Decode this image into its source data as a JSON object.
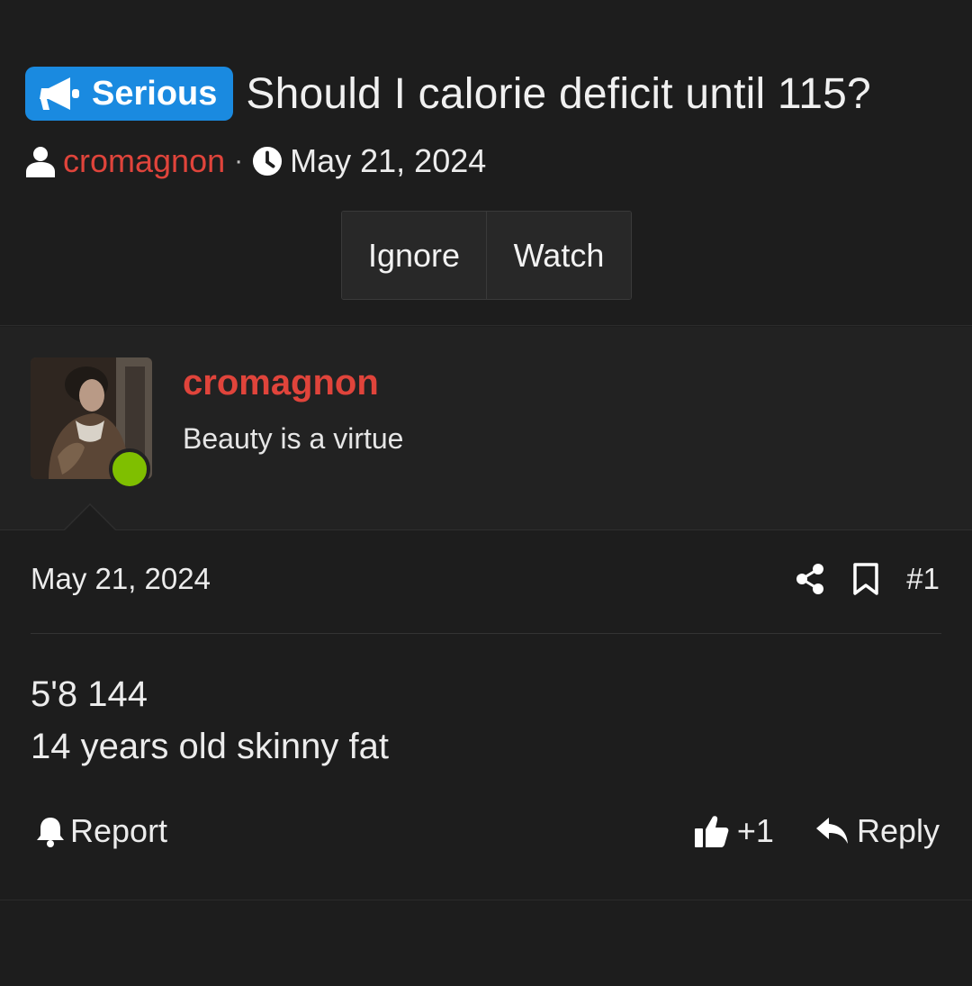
{
  "thread": {
    "prefix": "Serious",
    "title": "Should I calorie deficit until 115?",
    "author": "cromagnon",
    "separator": "·",
    "date": "May 21, 2024",
    "ignore_label": "Ignore",
    "watch_label": "Watch"
  },
  "user": {
    "name": "cromagnon",
    "title": "Beauty is a virtue",
    "online": true
  },
  "post": {
    "date": "May 21, 2024",
    "number": "#1",
    "lines": [
      "5'8 144",
      "14 years old skinny fat"
    ],
    "report_label": "Report",
    "reaction_count": "+1",
    "reply_label": "Reply"
  },
  "colors": {
    "background": "#1d1d1d",
    "prefix_badge": "#1a8ae0",
    "username": "#e0443b",
    "online": "#7fbf00"
  },
  "icons": [
    "megaphone-icon",
    "user-icon",
    "clock-icon",
    "share-icon",
    "bookmark-icon",
    "bell-icon",
    "thumbs-up-icon",
    "reply-icon"
  ]
}
